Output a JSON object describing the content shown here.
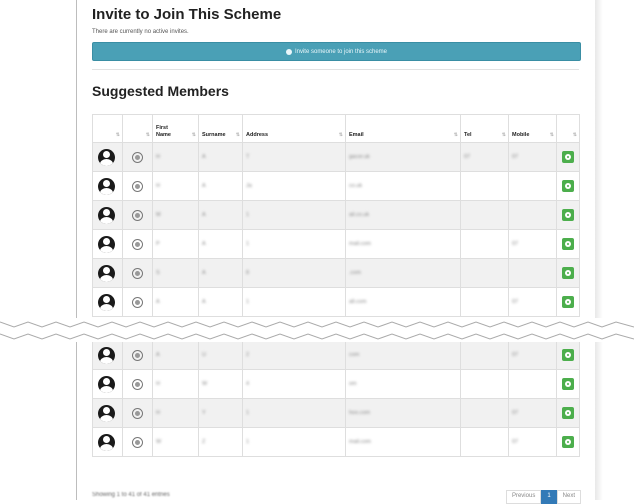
{
  "invite": {
    "title": "Invite to Join This Scheme",
    "note": "There are currently no active invites.",
    "button_label": "Invite someone to join this scheme"
  },
  "suggested": {
    "title": "Suggested Members",
    "columns": [
      "",
      "",
      "First Name",
      "Surname",
      "Address",
      "Email",
      "Tel",
      "Mobile",
      ""
    ]
  },
  "rows_top": [
    {
      "first": "H",
      "surname": "A",
      "address": "T",
      "email": "gacor.uk",
      "tel": "07",
      "mobile": "07"
    },
    {
      "first": "H",
      "surname": "A",
      "address": "Ja",
      "email": "co.uk",
      "tel": "",
      "mobile": ""
    },
    {
      "first": "M",
      "surname": "A",
      "address": "1",
      "email": "ail.co.uk",
      "tel": "",
      "mobile": ""
    },
    {
      "first": "P",
      "surname": "A",
      "address": "1",
      "email": "mail.com",
      "tel": "",
      "mobile": "07"
    },
    {
      "first": "S",
      "surname": "A",
      "address": "8",
      "email": ".com",
      "tel": "",
      "mobile": ""
    },
    {
      "first": "A",
      "surname": "A",
      "address": "1",
      "email": "all.com",
      "tel": "",
      "mobile": "07"
    }
  ],
  "rows_bottom": [
    {
      "first": "A",
      "surname": "U",
      "address": "2",
      "email": "com",
      "tel": "",
      "mobile": "07"
    },
    {
      "first": "H",
      "surname": "W",
      "address": "4",
      "email": "om",
      "tel": "",
      "mobile": ""
    },
    {
      "first": "H",
      "surname": "Y",
      "address": "1",
      "email": "hoo.com",
      "tel": "",
      "mobile": "07"
    },
    {
      "first": "W",
      "surname": "Z",
      "address": "1",
      "email": "mail.com",
      "tel": "",
      "mobile": "07"
    }
  ],
  "pagination": {
    "info": "Showing 1 to 41 of 41 entries",
    "previous": "Previous",
    "page": "1",
    "next": "Next"
  },
  "colors": {
    "accent": "#4aa0b6",
    "add": "#4cae4c",
    "page_active": "#337ab7"
  }
}
